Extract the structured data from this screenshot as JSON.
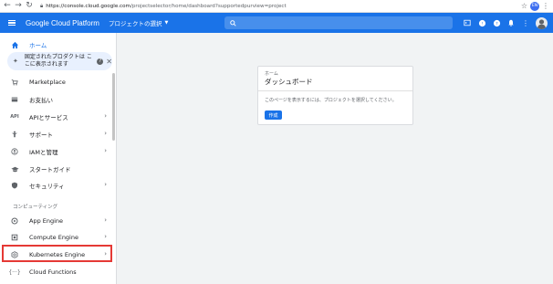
{
  "browser": {
    "url_host": "https://console.cloud.google.com",
    "url_path": "/projectselector/home/dashboard?supportedpurview=project",
    "profile_initials": "EN"
  },
  "appbar": {
    "title": "Google Cloud Platform",
    "project_select": "プロジェクトの選択",
    "accent": "#1a73e8"
  },
  "sidebar": {
    "home": "ホーム",
    "pinned_text": "固定されたプロダクトは ここに表示されます",
    "items": [
      {
        "label": "Marketplace",
        "icon": "cart-icon"
      },
      {
        "label": "お支払い",
        "icon": "billing-icon"
      },
      {
        "label": "APIとサービス",
        "icon": "api-icon"
      },
      {
        "label": "サポート",
        "icon": "support-icon"
      },
      {
        "label": "IAMと管理",
        "icon": "shield-icon"
      },
      {
        "label": "スタートガイド",
        "icon": "graduation-icon"
      },
      {
        "label": "セキュリティ",
        "icon": "security-icon"
      }
    ],
    "section_compute": "コンピューティング",
    "compute_items": [
      {
        "label": "App Engine",
        "icon": "app-engine-icon"
      },
      {
        "label": "Compute Engine",
        "icon": "compute-engine-icon"
      },
      {
        "label": "Kubernetes Engine",
        "icon": "kubernetes-icon"
      },
      {
        "label": "Cloud Functions",
        "icon": "functions-icon"
      }
    ]
  },
  "main": {
    "breadcrumb": "ホーム",
    "title": "ダッシュボード",
    "message": "このページを表示するには、プロジェクトを選択してください。",
    "create_button": "作成"
  }
}
